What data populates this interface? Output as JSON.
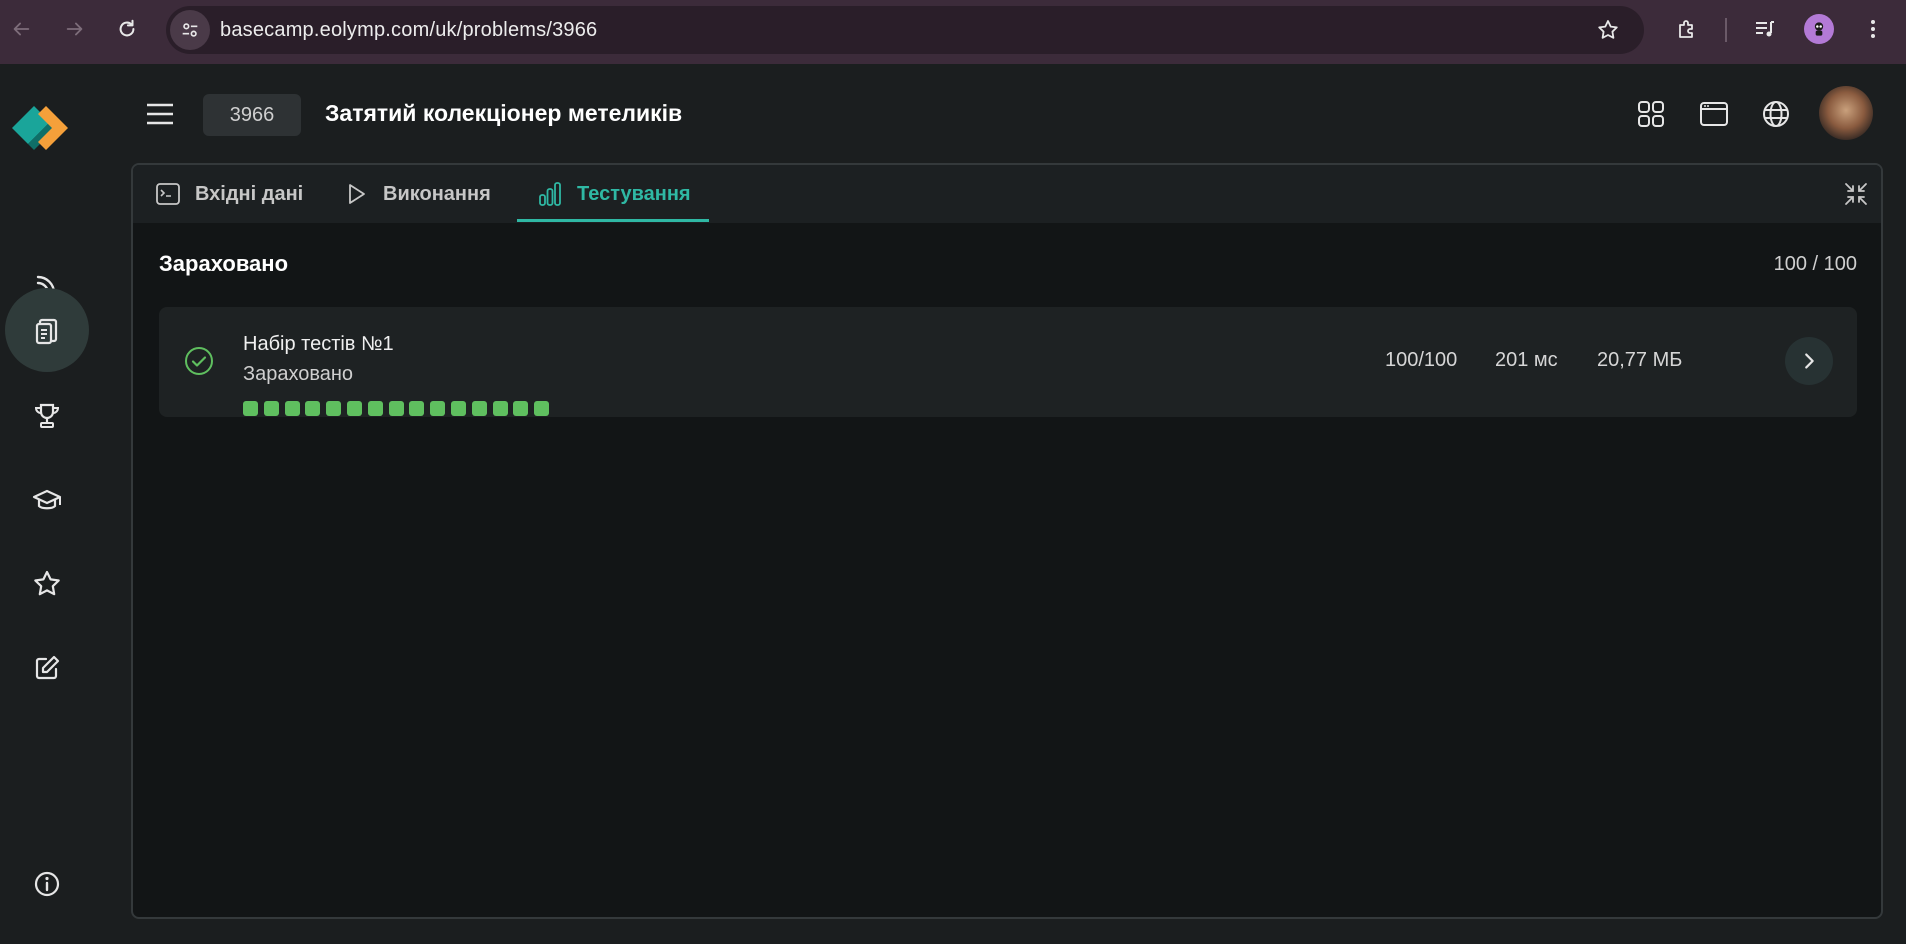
{
  "browser": {
    "url": "basecamp.eolymp.com/uk/problems/3966"
  },
  "problem": {
    "id": "3966",
    "title": "Затятий колекціонер метеликів"
  },
  "tabs": [
    {
      "label": "Вхідні дані",
      "icon": "terminal-icon"
    },
    {
      "label": "Виконання",
      "icon": "play-icon"
    },
    {
      "label": "Тестування",
      "icon": "bar-chart-icon",
      "active": true
    }
  ],
  "result": {
    "verdict": "Зараховано",
    "score": "100 / 100"
  },
  "testset": {
    "name": "Набір тестів №1",
    "status": "Зараховано",
    "points": "100/100",
    "time": "201 мс",
    "memory": "20,77 МБ",
    "passed_tests": 15,
    "dot_color": "#5fbf5f"
  },
  "colors": {
    "accent": "#2fb8a4",
    "success": "#5fbf5f",
    "logo_teal": "#1aa59a",
    "logo_orange": "#f5a03a"
  }
}
